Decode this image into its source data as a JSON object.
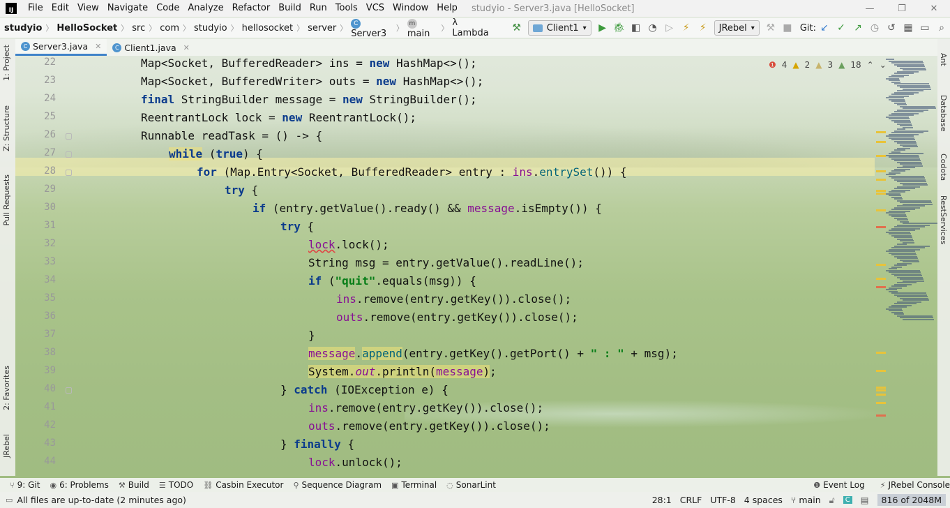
{
  "menubar": {
    "logo": "IJ",
    "items": [
      "File",
      "Edit",
      "View",
      "Navigate",
      "Code",
      "Analyze",
      "Refactor",
      "Build",
      "Run",
      "Tools",
      "VCS",
      "Window",
      "Help"
    ],
    "title": "studyio - Server3.java [HelloSocket]"
  },
  "nav": {
    "crumbs": [
      "studyio",
      "HelloSocket",
      "src",
      "com",
      "studyio",
      "hellosocket",
      "server",
      "Server3",
      "main",
      "Lambda"
    ],
    "run_config": "Client1",
    "jrebel": "JRebel",
    "git_label": "Git:"
  },
  "tabs": [
    {
      "label": "Server3.java",
      "active": true
    },
    {
      "label": "Client1.java",
      "active": false
    }
  ],
  "left_tools": [
    "1: Project",
    "Z: Structure",
    "Pull Requests",
    "2: Favorites",
    "JRebel"
  ],
  "right_tools": [
    "Ant",
    "Database",
    "Codota",
    "RestServices"
  ],
  "inspections": {
    "errors": "4",
    "warnings": "2",
    "weak_warnings": "3",
    "typos": "18"
  },
  "lines": [
    {
      "n": "22",
      "segs": [
        [
          "",
          "Map<Socket, BufferedReader> ins = "
        ],
        [
          "kw",
          "new"
        ],
        [
          "",
          " HashMap<>();"
        ]
      ]
    },
    {
      "n": "23",
      "segs": [
        [
          "",
          "Map<Socket, BufferedWriter> outs = "
        ],
        [
          "kw",
          "new"
        ],
        [
          "",
          " HashMap<>();"
        ]
      ]
    },
    {
      "n": "24",
      "segs": [
        [
          "kw",
          "final"
        ],
        [
          "",
          " StringBuilder message = "
        ],
        [
          "kw",
          "new"
        ],
        [
          "",
          " StringBuilder();"
        ]
      ]
    },
    {
      "n": "25",
      "segs": [
        [
          "",
          "ReentrantLock lock = "
        ],
        [
          "kw",
          "new"
        ],
        [
          "",
          " ReentrantLock();"
        ]
      ]
    },
    {
      "n": "26",
      "segs": [
        [
          "",
          "Runnable readTask = () -> {"
        ]
      ]
    },
    {
      "n": "27",
      "segs": [
        [
          "kw bg",
          "while"
        ],
        [
          "",
          " ("
        ],
        [
          "kw",
          "true"
        ],
        [
          "",
          ") {"
        ]
      ]
    },
    {
      "n": "28",
      "segs": [
        [
          "kw",
          "for"
        ],
        [
          "",
          " (Map.Entry<Socket, BufferedReader> entry : "
        ],
        [
          "fld",
          "ins"
        ],
        [
          "",
          "."
        ],
        [
          "mt",
          "entrySet"
        ],
        [
          "",
          "()) {"
        ]
      ]
    },
    {
      "n": "29",
      "segs": [
        [
          "kw",
          "try"
        ],
        [
          "",
          " {"
        ]
      ]
    },
    {
      "n": "30",
      "segs": [
        [
          "kw",
          "if"
        ],
        [
          "",
          " (entry.getValue().ready() && "
        ],
        [
          "fld",
          "message"
        ],
        [
          "",
          ".isEmpty()) {"
        ]
      ]
    },
    {
      "n": "31",
      "segs": [
        [
          "kw",
          "try"
        ],
        [
          "",
          " {"
        ]
      ]
    },
    {
      "n": "32",
      "segs": [
        [
          "fld err",
          "lock"
        ],
        [
          "",
          ".lock();"
        ]
      ]
    },
    {
      "n": "33",
      "segs": [
        [
          "",
          "String msg = entry.getValue().readLine();"
        ]
      ]
    },
    {
      "n": "34",
      "segs": [
        [
          "kw",
          "if"
        ],
        [
          "",
          " ("
        ],
        [
          "str",
          "\"quit\""
        ],
        [
          "",
          ".equals(msg)) {"
        ]
      ]
    },
    {
      "n": "35",
      "segs": [
        [
          "fld",
          "ins"
        ],
        [
          "",
          ".remove(entry.getKey()).close();"
        ]
      ]
    },
    {
      "n": "36",
      "segs": [
        [
          "fld",
          "outs"
        ],
        [
          "",
          ".remove(entry.getKey()).close();"
        ]
      ]
    },
    {
      "n": "37",
      "segs": [
        [
          "",
          "}"
        ]
      ]
    },
    {
      "n": "38",
      "segs": [
        [
          "fld bg",
          "message"
        ],
        [
          "",
          "."
        ],
        [
          "mt bg",
          "append"
        ],
        [
          "",
          "(entry.getKey().getPort() + "
        ],
        [
          "str",
          "\" : \""
        ],
        [
          "",
          " + msg);"
        ]
      ]
    },
    {
      "n": "39",
      "segs": [
        [
          "bg",
          "System."
        ],
        [
          "it bg",
          "out"
        ],
        [
          "bg",
          ".println("
        ],
        [
          "fld bg",
          "message"
        ],
        [
          "bg",
          ")"
        ],
        [
          "",
          ";"
        ]
      ]
    },
    {
      "n": "40",
      "segs": [
        [
          "",
          "} "
        ],
        [
          "kw",
          "catch"
        ],
        [
          "",
          " (IOException e) {"
        ]
      ]
    },
    {
      "n": "41",
      "segs": [
        [
          "fld",
          "ins"
        ],
        [
          "",
          ".remove(entry.getKey()).close();"
        ]
      ]
    },
    {
      "n": "42",
      "segs": [
        [
          "fld",
          "outs"
        ],
        [
          "",
          ".remove(entry.getKey()).close();"
        ]
      ]
    },
    {
      "n": "43",
      "segs": [
        [
          "",
          "} "
        ],
        [
          "kw",
          "finally"
        ],
        [
          "",
          " {"
        ]
      ]
    },
    {
      "n": "44",
      "segs": [
        [
          "fld",
          "lock"
        ],
        [
          "",
          ".unlock();"
        ]
      ]
    }
  ],
  "bottom_tools": [
    {
      "label": "9: Git",
      "icon": "git-branch-icon"
    },
    {
      "label": "6: Problems",
      "icon": "problems-icon"
    },
    {
      "label": "Build",
      "icon": "hammer-icon"
    },
    {
      "label": "TODO",
      "icon": "list-icon"
    },
    {
      "label": "Casbin Executor",
      "icon": "casbin-icon"
    },
    {
      "label": "Sequence Diagram",
      "icon": "sequence-icon"
    },
    {
      "label": "Terminal",
      "icon": "terminal-icon"
    },
    {
      "label": "SonarLint",
      "icon": "sonarlint-icon"
    }
  ],
  "bottom_right_tools": [
    {
      "label": "Event Log",
      "icon": "event-log-icon"
    },
    {
      "label": "JRebel Console",
      "icon": "jrebel-icon"
    }
  ],
  "status": {
    "message": "All files are up-to-date (2 minutes ago)",
    "position": "28:1",
    "line_sep": "CRLF",
    "encoding": "UTF-8",
    "indent": "4 spaces",
    "branch": "main",
    "memory": "816 of 2048M"
  }
}
